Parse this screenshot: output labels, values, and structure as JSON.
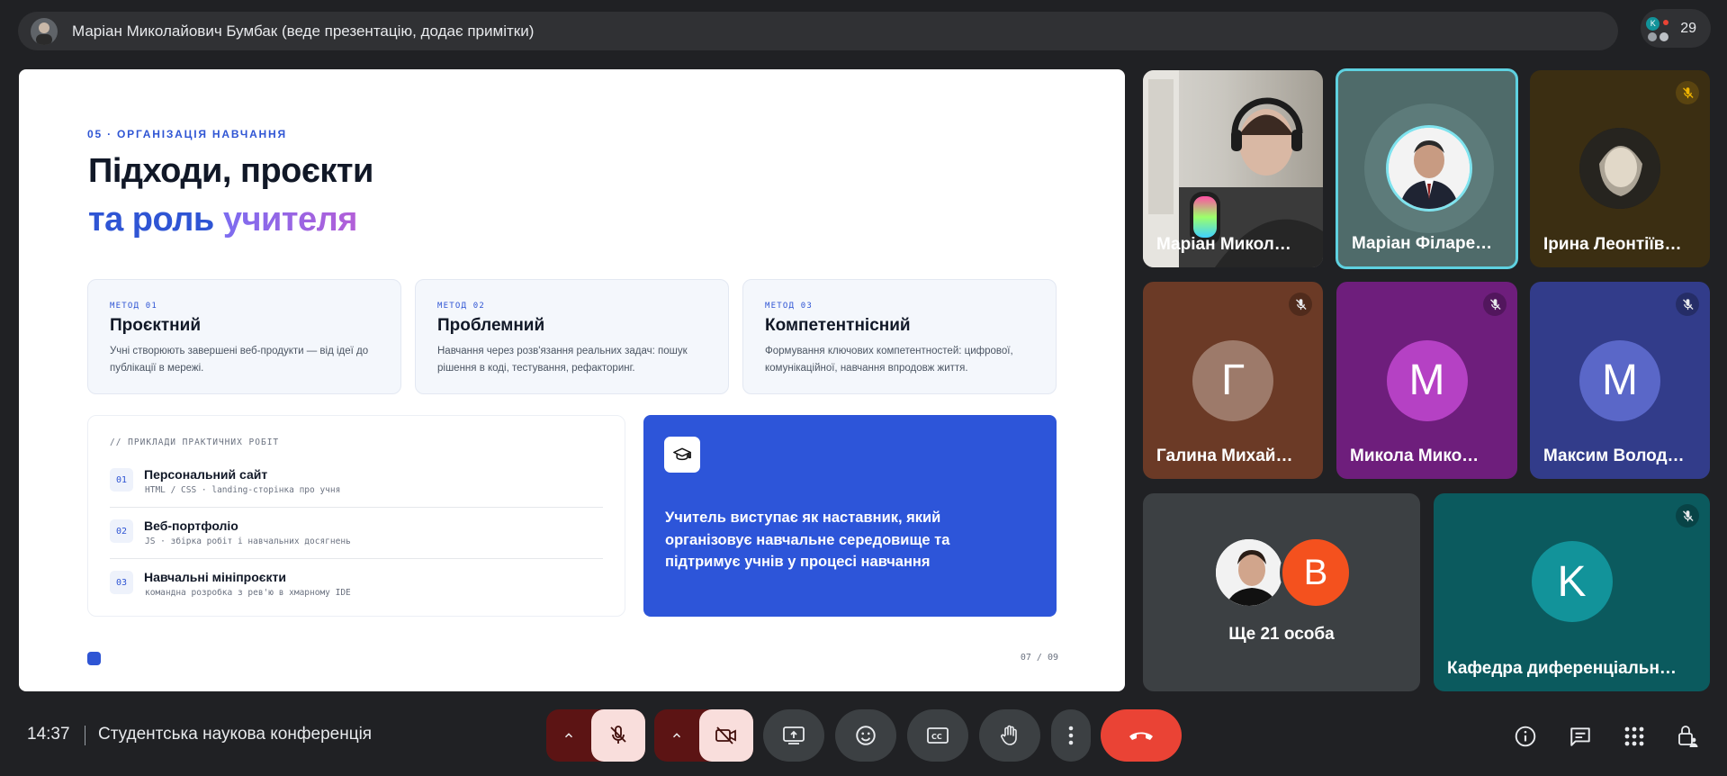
{
  "presenter_bar": {
    "text": "Маріан Миколайович Бумбак (веде презентацію, додає примітки)",
    "people_count": "29",
    "mini_initial": "K"
  },
  "slide": {
    "kicker": "05 · ОРГАНІЗАЦІЯ НАВЧАННЯ",
    "title_line1": "Підходи, проєкти",
    "title_line2_a": "та роль ",
    "title_line2_b": "учителя",
    "methods": [
      {
        "tag": "МЕТОД 01",
        "title": "Проєктний",
        "desc": "Учні створюють завершені веб-продукти — від ідеї до публікації в мережі."
      },
      {
        "tag": "МЕТОД 02",
        "title": "Проблемний",
        "desc": "Навчання через розв'язання реальних задач: пошук рішення в коді, тестування, рефакторинг."
      },
      {
        "tag": "МЕТОД 03",
        "title": "Компетентнісний",
        "desc": "Формування ключових компетентностей: цифрової, комунікаційної, навчання впродовж життя."
      }
    ],
    "examples_heading": "// ПРИКЛАДИ ПРАКТИЧНИХ РОБІТ",
    "examples": [
      {
        "num": "01",
        "title": "Персональний сайт",
        "sub": "HTML / CSS · landing-сторінка про учня"
      },
      {
        "num": "02",
        "title": "Веб-портфоліо",
        "sub": "JS · збірка робіт і навчальних досягнень"
      },
      {
        "num": "03",
        "title": "Навчальні мініпроєкти",
        "sub": "командна розробка з рев'ю в хмарному IDE"
      }
    ],
    "teacher_text": "Учитель виступає як наставник, який організовує навчальне середовище та підтримує учнів у процесі навчання",
    "page": "07 / 09"
  },
  "tiles": {
    "t1": {
      "name": "Маріан Микол…"
    },
    "t2": {
      "name": "Маріан Філаре…"
    },
    "t3": {
      "name": "Ірина Леонтіїв…"
    },
    "t4": {
      "name": "Галина Михай…",
      "initial": "Г",
      "bg": "#6b3a26",
      "avatar": "#9d7a6a"
    },
    "t5": {
      "name": "Микола Мико…",
      "initial": "M",
      "bg": "#6e1e7c",
      "avatar": "#b541c4"
    },
    "t6": {
      "name": "Максим Волод…",
      "initial": "M",
      "bg": "#323c8a",
      "avatar": "#5a67c8"
    },
    "t7": {
      "more": "Ще 21 особа",
      "initial": "B"
    },
    "t8": {
      "name": "Кафедра диференціальн…",
      "initial": "K",
      "bg": "#0b5a5e",
      "avatar": "#12939a"
    }
  },
  "bottom": {
    "time": "14:37",
    "meeting_name": "Студентська наукова конференція"
  },
  "colors": {
    "accent": "#2f55d4",
    "end_call": "#ea4335",
    "muted_control": "#f9dedc"
  }
}
